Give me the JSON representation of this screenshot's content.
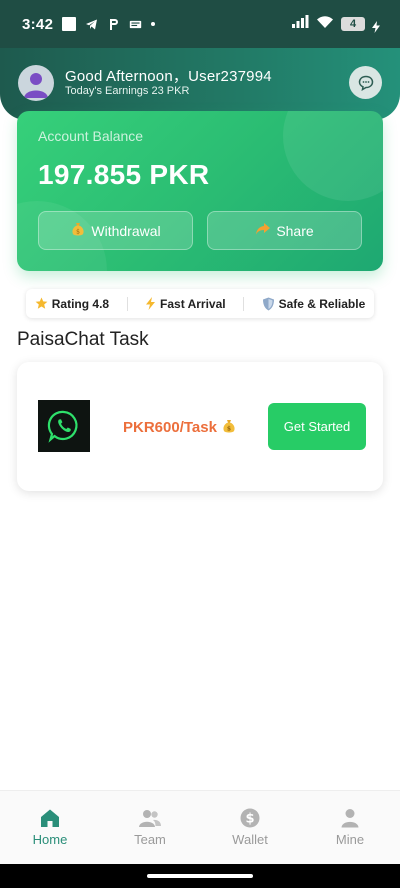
{
  "status_bar": {
    "time": "3:42",
    "battery": "4",
    "icons": [
      "square-icon",
      "telegram-icon",
      "p-icon",
      "app-badge-icon",
      "dot-icon",
      "signal-icon",
      "wifi-icon",
      "battery-icon"
    ]
  },
  "header": {
    "greeting": "Good Afternoon，User237994",
    "earnings": "Today's Earnings 23 PKR",
    "avatar_icon": "user-icon",
    "chat_icon": "chat-bubble-icon"
  },
  "balance": {
    "label": "Account Balance",
    "value": "197.855 PKR",
    "withdraw_label": "Withdrawal",
    "share_label": "Share",
    "colors": {
      "card_start": "#36d07a",
      "card_end": "#1ea872"
    }
  },
  "features": [
    {
      "icon": "star-icon",
      "label": "Rating 4.8"
    },
    {
      "icon": "lightning-icon",
      "label": "Fast Arrival"
    },
    {
      "icon": "shield-icon",
      "label": "Safe & Reliable"
    }
  ],
  "task_section": {
    "title": "PaisaChat Task",
    "price": "PKR600/Task",
    "button": "Get Started",
    "thumb_icon": "whatsapp-icon",
    "colors": {
      "price": "#ec6f3c",
      "button": "#27cc66"
    }
  },
  "nav": {
    "items": [
      {
        "label": "Home",
        "icon": "home-icon",
        "active": true
      },
      {
        "label": "Team",
        "icon": "team-icon",
        "active": false
      },
      {
        "label": "Wallet",
        "icon": "dollar-icon",
        "active": false
      },
      {
        "label": "Mine",
        "icon": "person-icon",
        "active": false
      }
    ],
    "active_color": "#2a8e79"
  }
}
